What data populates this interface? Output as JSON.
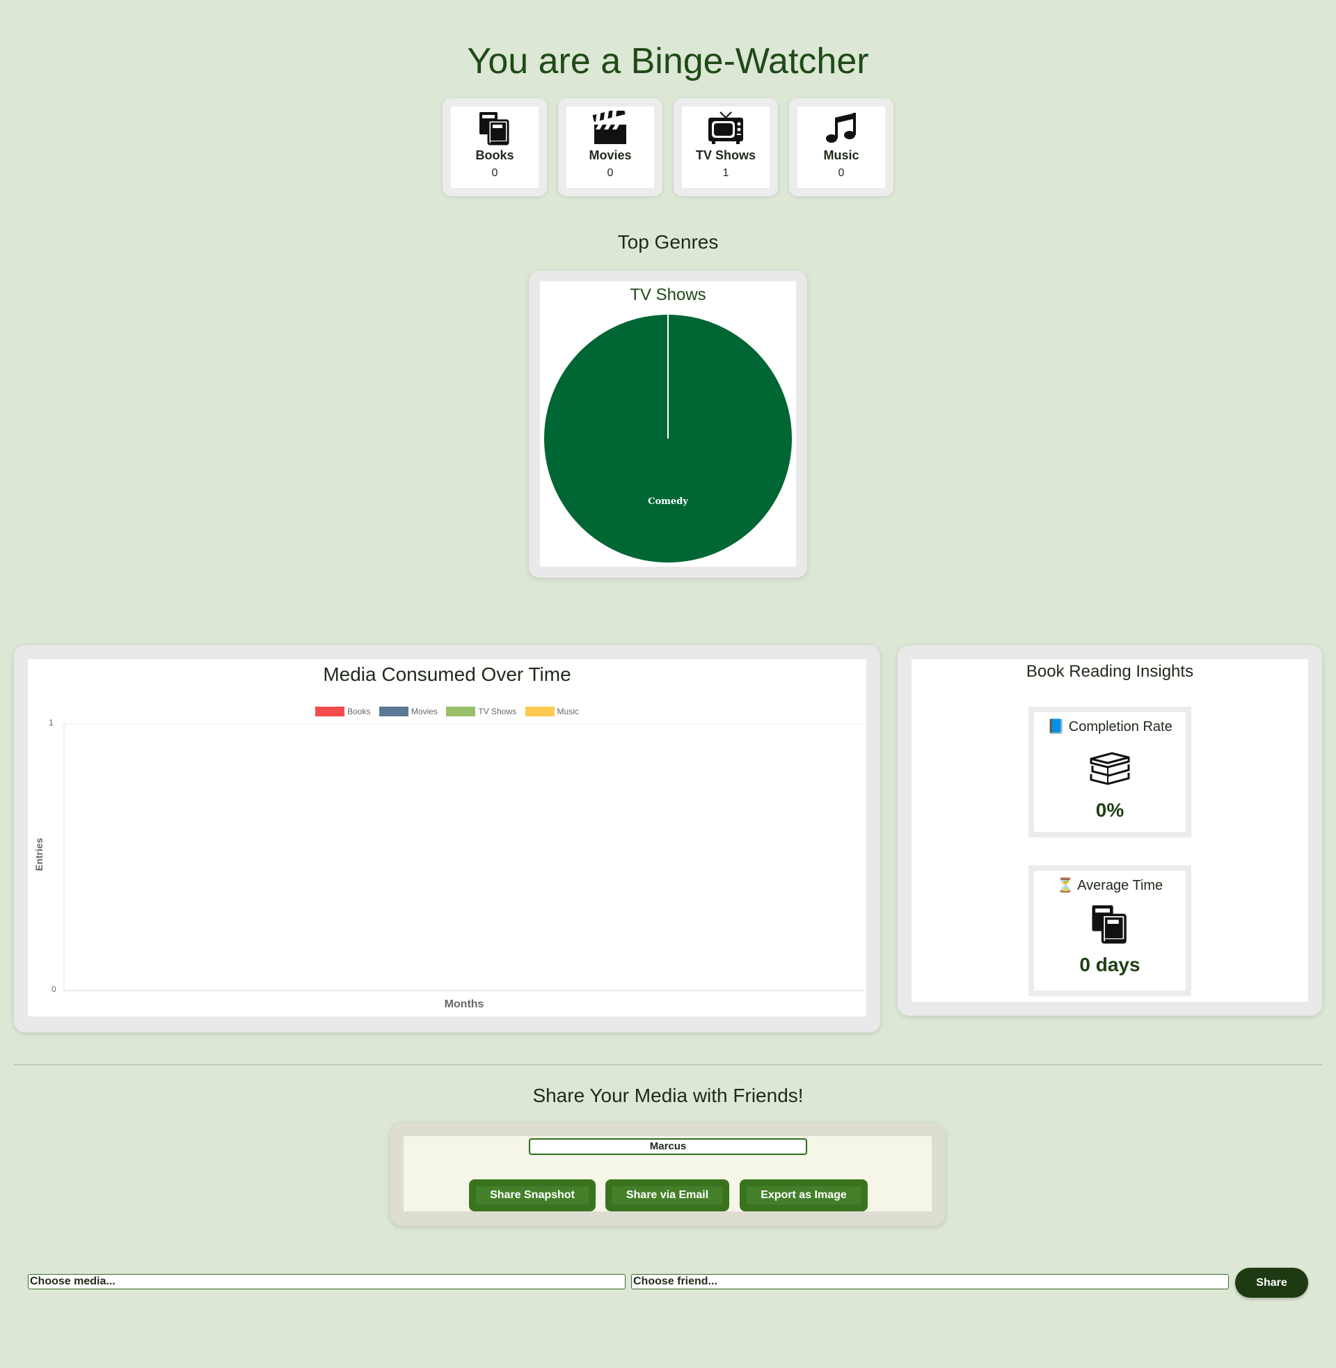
{
  "page": {
    "title": "You are a Binge-Watcher"
  },
  "stats": [
    {
      "label": "Books",
      "value": "0",
      "icon": "books-icon"
    },
    {
      "label": "Movies",
      "value": "0",
      "icon": "clapperboard-icon"
    },
    {
      "label": "TV Shows",
      "value": "1",
      "icon": "television-icon"
    },
    {
      "label": "Music",
      "value": "0",
      "icon": "music-note-icon"
    }
  ],
  "top_genres": {
    "heading": "Top Genres",
    "card_title": "TV Shows"
  },
  "media_chart": {
    "title": "Media Consumed Over Time"
  },
  "chart_data": [
    {
      "type": "pie",
      "title": "TV Shows",
      "labels": [
        "Comedy"
      ],
      "values": [
        1
      ],
      "colors": [
        "#006633"
      ]
    },
    {
      "type": "line",
      "title": "Media Consumed Over Time",
      "xlabel": "Months",
      "ylabel": "Entries",
      "ylim": [
        0,
        1
      ],
      "y_ticks": [
        "1",
        "0"
      ],
      "x": [],
      "series": [
        {
          "name": "Books",
          "values": [],
          "color": "#f44c4c"
        },
        {
          "name": "Movies",
          "values": [],
          "color": "#5b7a96"
        },
        {
          "name": "TV Shows",
          "values": [],
          "color": "#98bf6c"
        },
        {
          "name": "Music",
          "values": [],
          "color": "#fcca4f"
        }
      ],
      "legend": "top",
      "grid": false
    }
  ],
  "insights": {
    "title": "Book Reading Insights",
    "completion": {
      "emoji": "📘",
      "label": "Completion Rate",
      "value": "0%",
      "icon": "stacked-books-icon"
    },
    "average": {
      "emoji": "⏳",
      "label": "Average Time",
      "value": "0 days",
      "icon": "books-icon"
    }
  },
  "share": {
    "heading": "Share Your Media with Friends!",
    "name_value": "Marcus",
    "buttons": [
      "Share Snapshot",
      "Share via Email",
      "Export as Image"
    ],
    "media_select": "Choose media...",
    "friend_select": "Choose friend...",
    "share_label": "Share"
  },
  "colors": {
    "background": "#dce7d5",
    "accent": "#3a7320",
    "pie": "#006633",
    "dark_button": "#1d3a12"
  }
}
